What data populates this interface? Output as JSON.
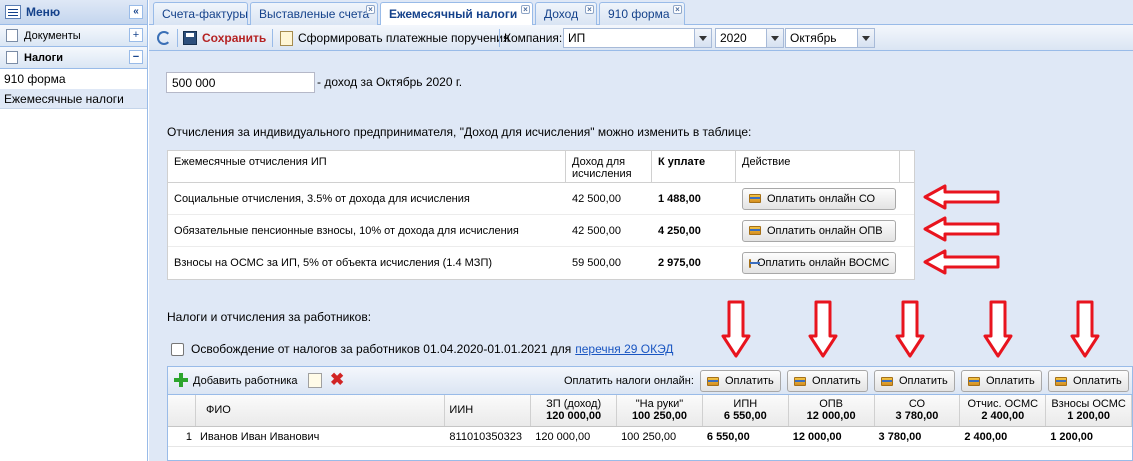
{
  "sidebar": {
    "menu_label": "Меню",
    "collapse_glyph": "«",
    "groups": [
      {
        "label": "Документы",
        "toggle": "+"
      },
      {
        "label": "Налоги",
        "toggle": "−"
      }
    ],
    "items": [
      {
        "label": "910 форма"
      },
      {
        "label": "Ежемесячные налоги"
      }
    ]
  },
  "tabs": [
    {
      "label": "Счета-фактуры"
    },
    {
      "label": "Выставленые счета"
    },
    {
      "label": "Ежемесячный налоги"
    },
    {
      "label": "Доход"
    },
    {
      "label": "910 форма"
    }
  ],
  "toolbar": {
    "save_label": "Сохранить",
    "generate_label": "Сформировать платежные поручения",
    "company_label": "Компания:",
    "company_value": "ИП",
    "year_value": "2020",
    "month_value": "Октябрь"
  },
  "income": {
    "value": "500 000",
    "suffix": "- доход за Октябрь 2020 г."
  },
  "ip_section": {
    "note": "Отчисления за индивидуального предпринимателя, \"Доход для исчисления\" можно изменить в таблице:",
    "headers": {
      "name": "Ежемесячные отчисления ИП",
      "base_line1": "Доход для",
      "base_line2": "исчисления",
      "amount": "К уплате",
      "action": "Действие"
    },
    "rows": [
      {
        "name": "Социальные отчисления, 3.5% от дохода для исчисления",
        "base": "42 500,00",
        "amount": "1 488,00",
        "button": "Оплатить онлайн СО"
      },
      {
        "name": "Обязательные пенсионные взносы, 10% от дохода для исчисления",
        "base": "42 500,00",
        "amount": "4 250,00",
        "button": "Оплатить онлайн ОПВ"
      },
      {
        "name": "Взносы на ОСМС за ИП, 5% от объекта исчисления (1.4 МЗП)",
        "base": "59 500,00",
        "amount": "2 975,00",
        "button": "Оплатить онлайн ВОСМС"
      }
    ]
  },
  "employees": {
    "title": "Налоги и отчисления за работников:",
    "exempt_text": "Освобождение от налогов за работников 01.04.2020-01.01.2021 для",
    "exempt_link": "перечня 29 ОКЭД",
    "add_label": "Добавить работника",
    "pay_label": "Оплатить налоги онлайн:",
    "pay_button": "Оплатить",
    "columns": [
      {
        "line1": "",
        "line2": ""
      },
      {
        "line1": "ФИО",
        "line2": ""
      },
      {
        "line1": "ИИН",
        "line2": ""
      },
      {
        "line1": "ЗП (доход)",
        "line2": "120 000,00"
      },
      {
        "line1": "\"На руки\"",
        "line2": "100 250,00"
      },
      {
        "line1": "ИПН",
        "line2": "6 550,00"
      },
      {
        "line1": "ОПВ",
        "line2": "12 000,00"
      },
      {
        "line1": "СО",
        "line2": "3 780,00"
      },
      {
        "line1": "Отчис. ОСМС",
        "line2": "2 400,00"
      },
      {
        "line1": "Взносы ОСМС",
        "line2": "1 200,00"
      }
    ],
    "rows": [
      {
        "num": "1",
        "name": "Иванов Иван Иванович",
        "iin": "811010350323",
        "salary": "120 000,00",
        "net": "100 250,00",
        "ipn": "6 550,00",
        "opv": "12 000,00",
        "so": "3 780,00",
        "osms": "2 400,00",
        "vosms": "1 200,00"
      }
    ]
  },
  "colors": {
    "annotation_arrow": "#e8141e",
    "panel_bg": "#dfe8f6",
    "border": "#99bbe8",
    "save_text": "#b52323",
    "link": "#1a56c2"
  }
}
